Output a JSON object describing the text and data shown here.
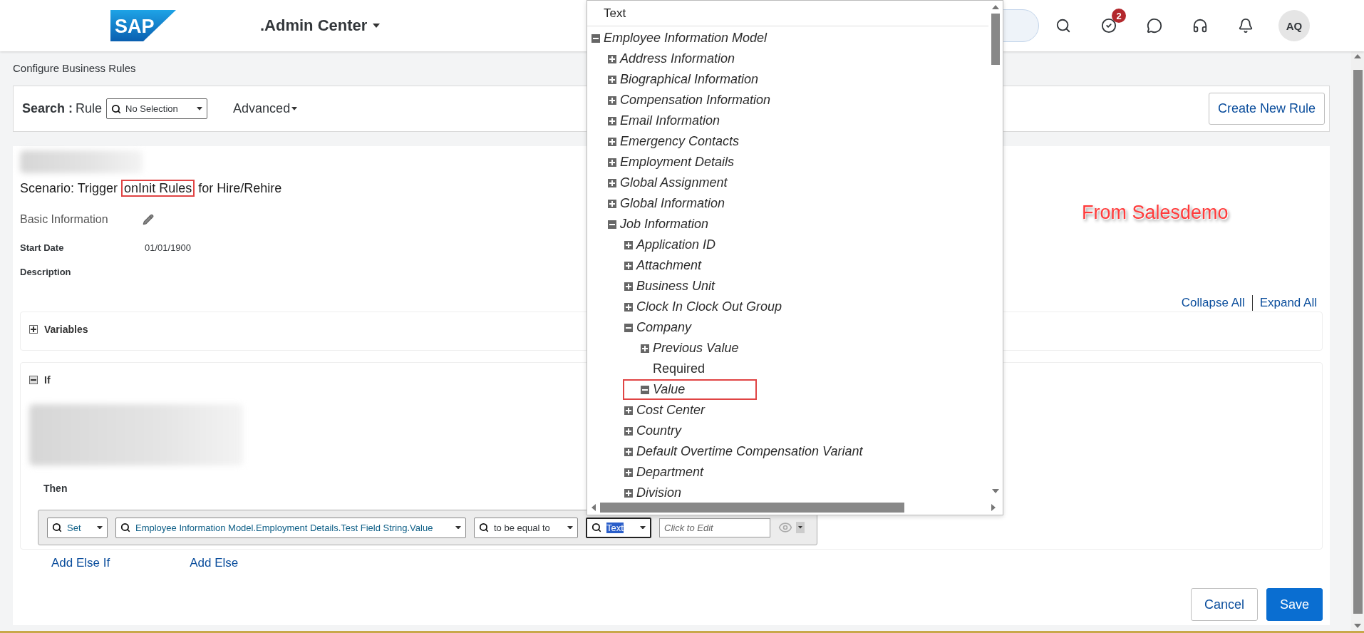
{
  "header": {
    "logo": "SAP",
    "app_title": ".Admin Center",
    "task_count": "2",
    "avatar_initials": "AQ"
  },
  "page_title": "Configure Business Rules",
  "search_bar": {
    "label": "Search :",
    "object": "Rule",
    "select_value": "No Selection",
    "advanced": "Advanced",
    "create_button": "Create New Rule"
  },
  "rule": {
    "scenario": {
      "before": "Scenario: Trigger",
      "annotated_part": "onInit Rules",
      "after": "for Hire/Rehire"
    },
    "basic_information": "Basic Information",
    "fields": [
      {
        "label": "Start Date",
        "value": "01/01/1900"
      },
      {
        "label": "Description"
      }
    ],
    "collapse_all": "Collapse All",
    "expand_all": "Expand All",
    "sections": [
      {
        "title": "Variables",
        "expanded": false
      },
      {
        "title": "If",
        "expanded": true
      }
    ],
    "then_label": "Then",
    "action": [
      {
        "kind": "select",
        "value": "Set",
        "linked": true,
        "focused": false,
        "text_selected": false
      },
      {
        "kind": "select",
        "value": "Employee Information Model.Employment Details.Test Field String.Value",
        "linked": true,
        "focused": false,
        "text_selected": false
      },
      {
        "kind": "select",
        "value": "to be equal to",
        "linked": false,
        "focused": false,
        "text_selected": false
      },
      {
        "kind": "select",
        "value": "Text",
        "linked": false,
        "focused": true,
        "text_selected": true
      },
      {
        "kind": "input",
        "placeholder": "Click to Edit"
      }
    ],
    "add_links": [
      "Add Else If",
      "Add Else"
    ]
  },
  "annotation": "From Salesdemo",
  "footer_buttons": [
    {
      "label": "Cancel",
      "kind": "secondary"
    },
    {
      "label": "Save",
      "kind": "primary"
    }
  ],
  "dropdown": {
    "header": "Text",
    "tree": [
      {
        "label": "Employee Information Model",
        "kind": "node",
        "expanded": true,
        "annotated": false,
        "children": [
          {
            "label": "Address Information",
            "kind": "node",
            "expanded": false,
            "annotated": false
          },
          {
            "label": "Biographical Information",
            "kind": "node",
            "expanded": false,
            "annotated": false
          },
          {
            "label": "Compensation Information",
            "kind": "node",
            "expanded": false,
            "annotated": false
          },
          {
            "label": "Email Information",
            "kind": "node",
            "expanded": false,
            "annotated": false
          },
          {
            "label": "Emergency Contacts",
            "kind": "node",
            "expanded": false,
            "annotated": false
          },
          {
            "label": "Employment Details",
            "kind": "node",
            "expanded": false,
            "annotated": false
          },
          {
            "label": "Global Assignment",
            "kind": "node",
            "expanded": false,
            "annotated": false
          },
          {
            "label": "Global Information",
            "kind": "node",
            "expanded": false,
            "annotated": false
          },
          {
            "label": "Job Information",
            "kind": "node",
            "expanded": true,
            "annotated": false,
            "children": [
              {
                "label": "Application ID",
                "kind": "node",
                "expanded": false,
                "annotated": false
              },
              {
                "label": "Attachment",
                "kind": "node",
                "expanded": false,
                "annotated": false
              },
              {
                "label": "Business Unit",
                "kind": "node",
                "expanded": false,
                "annotated": false
              },
              {
                "label": "Clock In Clock Out Group",
                "kind": "node",
                "expanded": false,
                "annotated": false
              },
              {
                "label": "Company",
                "kind": "node",
                "expanded": true,
                "annotated": false,
                "children": [
                  {
                    "label": "Previous Value",
                    "kind": "node",
                    "expanded": false,
                    "annotated": false
                  },
                  {
                    "label": "Required",
                    "kind": "leaf",
                    "annotated": false
                  },
                  {
                    "label": "Value",
                    "kind": "node",
                    "expanded": true,
                    "annotated": true
                  }
                ]
              },
              {
                "label": "Cost Center",
                "kind": "node",
                "expanded": false,
                "annotated": false
              },
              {
                "label": "Country",
                "kind": "node",
                "expanded": false,
                "annotated": false
              },
              {
                "label": "Default Overtime Compensation Variant",
                "kind": "node",
                "expanded": false,
                "annotated": false
              },
              {
                "label": "Department",
                "kind": "node",
                "expanded": false,
                "annotated": false
              },
              {
                "label": "Division",
                "kind": "node",
                "expanded": false,
                "annotated": false
              }
            ]
          }
        ]
      }
    ]
  }
}
